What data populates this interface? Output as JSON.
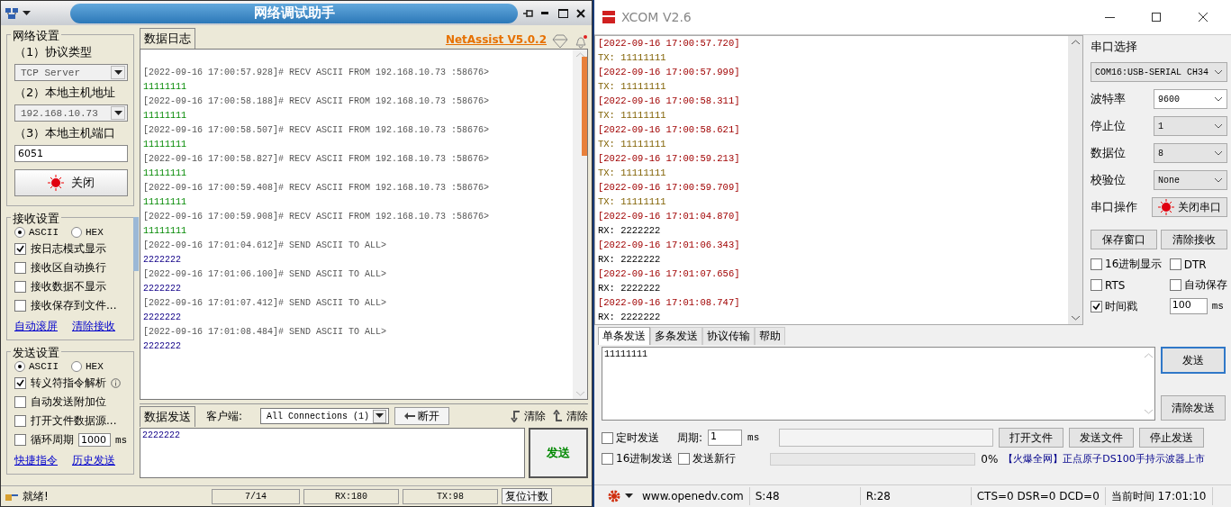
{
  "netassist": {
    "title": "网络调试助手",
    "brand": "NetAssist V5.0.2",
    "network_settings": {
      "title": "网络设置",
      "protocol_label": "（1）协议类型",
      "protocol": "TCP Server",
      "host_label": "（2）本地主机地址",
      "host": "192.168.10.73",
      "port_label": "（3）本地主机端口",
      "port": "6051",
      "button": "关闭"
    },
    "receive_settings": {
      "title": "接收设置",
      "modes": [
        {
          "label": "ASCII",
          "selected": true
        },
        {
          "label": "HEX",
          "selected": false
        }
      ],
      "options": [
        {
          "label": "按日志模式显示",
          "checked": true
        },
        {
          "label": "接收区自动换行",
          "checked": false
        },
        {
          "label": "接收数据不显示",
          "checked": false
        },
        {
          "label": "接收保存到文件...",
          "checked": false
        }
      ],
      "links": [
        "自动滚屏",
        "清除接收"
      ]
    },
    "send_settings": {
      "title": "发送设置",
      "modes": [
        {
          "label": "ASCII",
          "selected": true
        },
        {
          "label": "HEX",
          "selected": false
        }
      ],
      "options": [
        {
          "label": "转义符指令解析",
          "checked": true
        },
        {
          "label": "自动发送附加位",
          "checked": false
        },
        {
          "label": "打开文件数据源...",
          "checked": false
        }
      ],
      "cycle": {
        "label": "循环周期",
        "checked": false,
        "value": "1000",
        "unit": "ms"
      },
      "links": [
        "快捷指令",
        "历史发送"
      ]
    },
    "log_tab": "数据日志",
    "log": [
      {
        "kind": "recv",
        "header": "[2022-09-16 17:00:57.928]# RECV ASCII FROM 192.168.10.73 :58676>",
        "data": "11111111"
      },
      {
        "kind": "recv",
        "header": "[2022-09-16 17:00:58.188]# RECV ASCII FROM 192.168.10.73 :58676>",
        "data": "11111111"
      },
      {
        "kind": "recv",
        "header": "[2022-09-16 17:00:58.507]# RECV ASCII FROM 192.168.10.73 :58676>",
        "data": "11111111"
      },
      {
        "kind": "recv",
        "header": "[2022-09-16 17:00:58.827]# RECV ASCII FROM 192.168.10.73 :58676>",
        "data": "11111111"
      },
      {
        "kind": "recv",
        "header": "[2022-09-16 17:00:59.408]# RECV ASCII FROM 192.168.10.73 :58676>",
        "data": "11111111"
      },
      {
        "kind": "recv",
        "header": "[2022-09-16 17:00:59.908]# RECV ASCII FROM 192.168.10.73 :58676>",
        "data": "11111111"
      },
      {
        "kind": "send",
        "header": "[2022-09-16 17:01:04.612]# SEND ASCII TO ALL>",
        "data": "2222222"
      },
      {
        "kind": "send",
        "header": "[2022-09-16 17:01:06.100]# SEND ASCII TO ALL>",
        "data": "2222222"
      },
      {
        "kind": "send",
        "header": "[2022-09-16 17:01:07.412]# SEND ASCII TO ALL>",
        "data": "2222222"
      },
      {
        "kind": "send",
        "header": "[2022-09-16 17:01:08.484]# SEND ASCII TO ALL>",
        "data": "2222222"
      }
    ],
    "send_tab": "数据发送",
    "client_label": "客户端:",
    "client": "All Connections (1)",
    "disconnect": "断开",
    "clear_buttons": [
      "清除",
      "清除"
    ],
    "send_text": "2222222",
    "send_button": "发送",
    "status": {
      "message": "就绪!",
      "count": "7/14",
      "rx": "RX:180",
      "tx": "TX:98",
      "reset": "复位计数"
    }
  },
  "xcom": {
    "title": "XCOM V2.6",
    "log": [
      {
        "time": "[2022-09-16 17:00:57.720]",
        "kind": "tx",
        "text": "TX: 11111111"
      },
      {
        "time": "[2022-09-16 17:00:57.999]",
        "kind": "tx",
        "text": "TX: 11111111"
      },
      {
        "time": "[2022-09-16 17:00:58.311]",
        "kind": "tx",
        "text": "TX: 11111111"
      },
      {
        "time": "[2022-09-16 17:00:58.621]",
        "kind": "tx",
        "text": "TX: 11111111"
      },
      {
        "time": "[2022-09-16 17:00:59.213]",
        "kind": "tx",
        "text": "TX: 11111111"
      },
      {
        "time": "[2022-09-16 17:00:59.709]",
        "kind": "tx",
        "text": "TX: 11111111"
      },
      {
        "time": "[2022-09-16 17:01:04.870]",
        "kind": "rx",
        "text": "RX: 2222222"
      },
      {
        "time": "[2022-09-16 17:01:06.343]",
        "kind": "rx",
        "text": "RX: 2222222"
      },
      {
        "time": "[2022-09-16 17:01:07.656]",
        "kind": "rx",
        "text": "RX: 2222222"
      },
      {
        "time": "[2022-09-16 17:01:08.747]",
        "kind": "rx",
        "text": "RX: 2222222"
      }
    ],
    "port_label": "串口选择",
    "port": "COM16:USB-SERIAL CH34",
    "fields": [
      {
        "label": "波特率",
        "value": "9600"
      },
      {
        "label": "停止位",
        "value": "1"
      },
      {
        "label": "数据位",
        "value": "8"
      },
      {
        "label": "校验位",
        "value": "None"
      }
    ],
    "op_label": "串口操作",
    "op_button": "关闭串口",
    "buttons": [
      "保存窗口",
      "清除接收"
    ],
    "checkboxes": [
      {
        "label": "16进制显示",
        "checked": false
      },
      {
        "label": "DTR",
        "checked": false
      },
      {
        "label": "RTS",
        "checked": false
      },
      {
        "label": "自动保存",
        "checked": false
      },
      {
        "label": "时间戳",
        "checked": true
      }
    ],
    "timestamp_value": "100",
    "timestamp_unit": "ms",
    "tabs": [
      {
        "label": "单条发送",
        "selected": true
      },
      {
        "label": "多条发送",
        "selected": false
      },
      {
        "label": "协议传输",
        "selected": false
      },
      {
        "label": "帮助",
        "selected": false
      }
    ],
    "send_text": "11111111",
    "send_button": "发送",
    "clear_button": "清除发送",
    "timed_send": {
      "label": "定时发送",
      "checked": false
    },
    "period_label": "周期:",
    "period": "1",
    "period_unit": "ms",
    "hex_send": {
      "label": "16进制发送",
      "checked": false
    },
    "newline": {
      "label": "发送新行",
      "checked": false
    },
    "file_buttons": [
      "打开文件",
      "发送文件",
      "停止发送"
    ],
    "progress": {
      "level": 0,
      "text": "0%"
    },
    "ad": "【火爆全网】正点原子DS100手持示波器上市",
    "status": [
      "www.openedv.com",
      "S:48",
      "R:28",
      "CTS=0 DSR=0 DCD=0",
      "当前时间 17:01:10"
    ]
  }
}
